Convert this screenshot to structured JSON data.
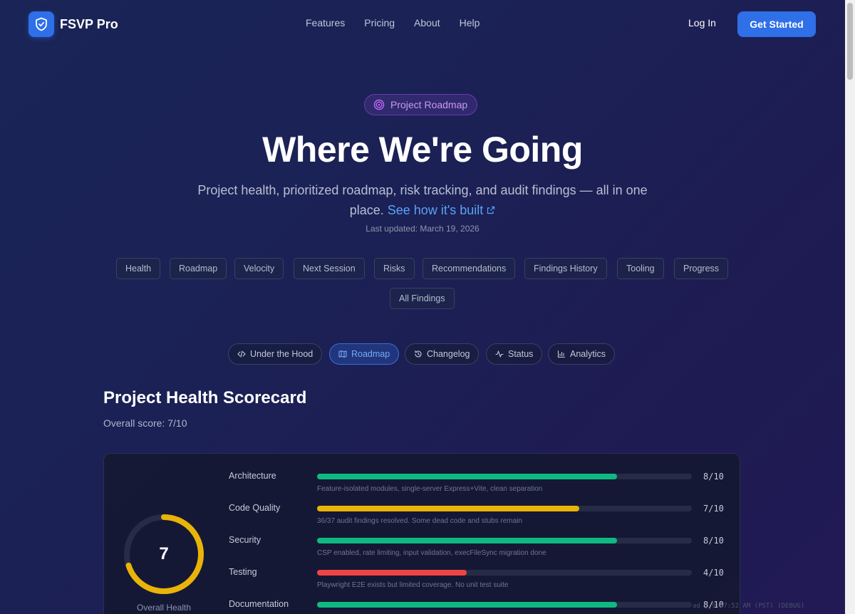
{
  "brand": {
    "name": "FSVP Pro"
  },
  "nav": {
    "links": [
      "Features",
      "Pricing",
      "About",
      "Help"
    ],
    "login": "Log In",
    "cta": "Get Started"
  },
  "hero": {
    "badge": "Project Roadmap",
    "title": "Where We're Going",
    "subtitle": "Project health, prioritized roadmap, risk tracking, and audit findings — all in one place.",
    "subtitle_link": "See how it's built",
    "updated": "Last updated: March 19, 2026"
  },
  "sections": [
    "Health",
    "Roadmap",
    "Velocity",
    "Next Session",
    "Risks",
    "Recommendations",
    "Findings History",
    "Tooling",
    "Progress",
    "All Findings"
  ],
  "tabs": [
    {
      "label": "Under the Hood",
      "icon": "code-icon",
      "active": false
    },
    {
      "label": "Roadmap",
      "icon": "map-icon",
      "active": true
    },
    {
      "label": "Changelog",
      "icon": "history-icon",
      "active": false
    },
    {
      "label": "Status",
      "icon": "activity-icon",
      "active": false
    },
    {
      "label": "Analytics",
      "icon": "bar-chart-icon",
      "active": false
    }
  ],
  "scorecard": {
    "title": "Project Health Scorecard",
    "overall": "Overall score: 7/10",
    "overall_value": 7,
    "overall_max": 10,
    "overall_label": "Overall Health",
    "rows": [
      {
        "label": "Architecture",
        "score": 8,
        "score_text": "8/10",
        "color": "#10b981",
        "note": "Feature-isolated modules, single-server Express+Vite, clean separation"
      },
      {
        "label": "Code Quality",
        "score": 7,
        "score_text": "7/10",
        "color": "#eab308",
        "note": "36/37 audit findings resolved. Some dead code and stubs remain"
      },
      {
        "label": "Security",
        "score": 8,
        "score_text": "8/10",
        "color": "#10b981",
        "note": "CSP enabled, rate limiting, input validation, execFileSync migration done"
      },
      {
        "label": "Testing",
        "score": 4,
        "score_text": "4/10",
        "color": "#ef4444",
        "note": "Playwright E2E exists but limited coverage. No unit test suite"
      },
      {
        "label": "Documentation",
        "score": 8,
        "score_text": "8/10",
        "color": "#10b981",
        "note": ""
      }
    ]
  },
  "debug": "ad | 9:57:52 AM (PST) (DEBUG)"
}
